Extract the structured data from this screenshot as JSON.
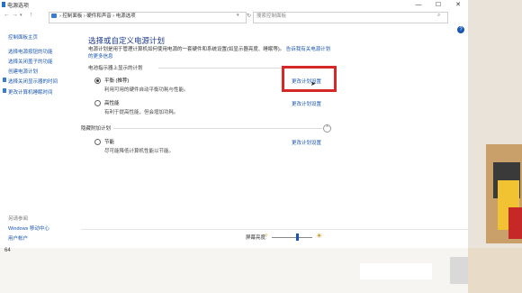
{
  "window": {
    "title": "电源选项",
    "buttons": {
      "minimize": "—",
      "maximize": "☐",
      "close": "✕"
    }
  },
  "addressbar": {
    "back": "←",
    "forward": "→",
    "up": "↑",
    "crumbs": "›  控制面板  ›  硬件和声音  ›  电源选项",
    "search_placeholder": "搜索控制面板"
  },
  "sidebar": {
    "home": "控制面板主页",
    "links": [
      "选择电源按钮的功能",
      "选择关闭盖子的功能",
      "创建电源计划",
      "选择关闭显示器的时间",
      "更改计算机睡眠时间"
    ],
    "see_also_title": "另请参阅",
    "see_also": [
      "Windows 移动中心",
      "用户帐户"
    ]
  },
  "main": {
    "title": "选择或自定义电源计划",
    "description": "电源计划是用于管理计算机如何使用电源的一套硬件和系统设置(如显示器亮度、睡眠等)。",
    "description_link": "告诉我有关电源计划的更多信息",
    "section_shown": "电池指示器上显示的计划",
    "section_hidden": "隐藏附加计划",
    "collapse_glyph": "^",
    "plans": [
      {
        "name": "平衡 (推荐)",
        "desc": "利用可用的硬件自动平衡功耗与性能。",
        "link": "更改计划设置",
        "selected": true
      },
      {
        "name": "高性能",
        "desc": "有利于提高性能，但会增加功耗。",
        "link": "更改计划设置",
        "selected": false
      },
      {
        "name": "节能",
        "desc": "尽可能降低计算机性能以节能。",
        "link": "更改计划设置",
        "selected": false
      }
    ]
  },
  "footer": {
    "brightness_label": "屏幕亮度:",
    "brightness_level": 0.63
  },
  "help_glyph": "?",
  "corner_text": "64",
  "colors": {
    "link": "#1a56b0",
    "highlight": "#d62828",
    "title": "#1e3a8a"
  }
}
